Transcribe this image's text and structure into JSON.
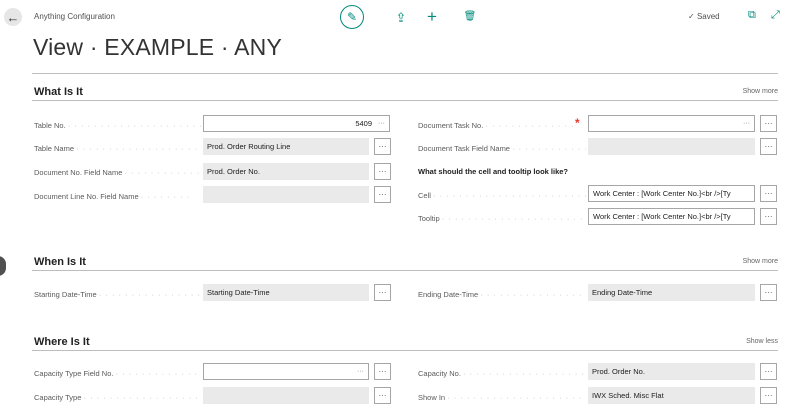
{
  "header": {
    "breadcrumb": "Anything Configuration",
    "title": "View · EXAMPLE · ANY",
    "saved_label": "Saved",
    "saved_check": "✓",
    "back_icon": "←",
    "edit_icon": "✎",
    "share_icon": "⇪",
    "new_icon": "+",
    "delete_icon": "🗑",
    "open_new_icon": "⧉",
    "expand_icon": "⤢"
  },
  "lookup_glyph": "···",
  "required_mark": "*",
  "sections": {
    "what": {
      "title": "What Is It",
      "toggle": "Show more",
      "fields": {
        "table_no": {
          "label": "Table No.",
          "value": "5409"
        },
        "table_name": {
          "label": "Table Name",
          "value": "Prod. Order Routing Line"
        },
        "doc_no_field": {
          "label": "Document No. Field Name",
          "value": "Prod. Order No."
        },
        "doc_line_field": {
          "label": "Document Line No. Field Name",
          "value": ""
        },
        "doc_task_no": {
          "label": "Document Task No.",
          "value": ""
        },
        "doc_task_field": {
          "label": "Document Task Field Name",
          "value": ""
        },
        "cell": {
          "label": "Cell",
          "value": "Work Center : [Work Center No.]<br />[Ty"
        },
        "tooltip": {
          "label": "Tooltip",
          "value": "Work Center : [Work Center No.]<br />[Ty"
        }
      },
      "subheading": "What should the cell and tooltip look like?"
    },
    "when": {
      "title": "When Is It",
      "toggle": "Show more",
      "fields": {
        "start": {
          "label": "Starting Date-Time",
          "value": "Starting Date-Time"
        },
        "end": {
          "label": "Ending Date-Time",
          "value": "Ending Date-Time"
        }
      }
    },
    "where": {
      "title": "Where Is It",
      "toggle": "Show less",
      "fields": {
        "cap_type_field": {
          "label": "Capacity Type Field No.",
          "value": ""
        },
        "cap_type": {
          "label": "Capacity Type",
          "value": ""
        },
        "cap_no": {
          "label": "Capacity No.",
          "value": "Prod. Order No."
        },
        "show_in": {
          "label": "Show In",
          "value": "IWX Sched. Misc Flat"
        }
      }
    }
  }
}
